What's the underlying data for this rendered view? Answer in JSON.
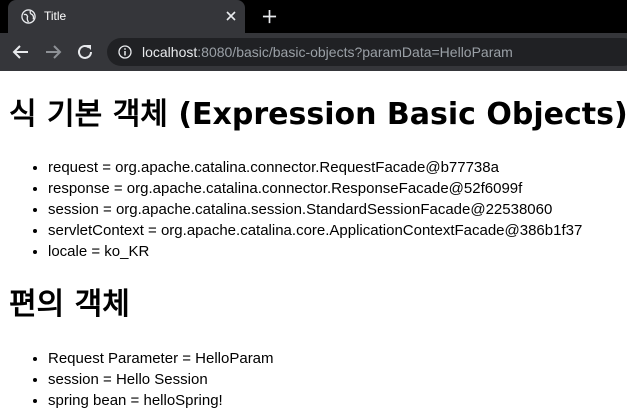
{
  "browser": {
    "tab": {
      "title": "Title",
      "favicon": "globe-icon",
      "close_icon": "close-icon"
    },
    "new_tab_icon": "plus-icon",
    "toolbar": {
      "back_icon": "back-arrow-icon",
      "forward_icon": "forward-arrow-icon",
      "reload_icon": "reload-icon",
      "info_icon": "info-icon",
      "url_host": "localhost",
      "url_rest": ":8080/basic/basic-objects?paramData=HelloParam"
    }
  },
  "page": {
    "basic_title": "식 기본 객체 (Expression Basic Objects)",
    "basic_items": [
      "request = org.apache.catalina.connector.RequestFacade@b77738a",
      "response = org.apache.catalina.connector.ResponseFacade@52f6099f",
      "session = org.apache.catalina.session.StandardSessionFacade@22538060",
      "servletContext = org.apache.catalina.core.ApplicationContextFacade@386b1f37",
      "locale = ko_KR"
    ],
    "convenience_title": "편의 객체",
    "convenience_items": [
      "Request Parameter = HelloParam",
      "session = Hello Session",
      "spring bean = helloSpring!"
    ]
  }
}
